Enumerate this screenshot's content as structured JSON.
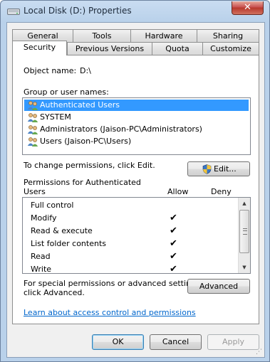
{
  "window": {
    "title": "Local Disk (D:) Properties",
    "close_label": "✕"
  },
  "tabs": {
    "row_back": [
      "General",
      "Tools",
      "Hardware",
      "Sharing"
    ],
    "row_front": [
      "Security",
      "Previous Versions",
      "Quota",
      "Customize"
    ],
    "active": "Security"
  },
  "security": {
    "object_name_label": "Object name:",
    "object_name_value": "D:\\",
    "group_label": "Group or user names:",
    "users": [
      "Authenticated Users",
      "SYSTEM",
      "Administrators (Jaison-PC\\Administrators)",
      "Users (Jaison-PC\\Users)"
    ],
    "selected_user": "Authenticated Users",
    "change_text": "To change permissions, click Edit.",
    "edit_button": "Edit...",
    "permissions_header_line1": "Permissions for Authenticated",
    "permissions_header_line2": "Users",
    "allow_label": "Allow",
    "deny_label": "Deny",
    "permissions": [
      {
        "name": "Full control",
        "allow": ""
      },
      {
        "name": "Modify",
        "allow": "✔"
      },
      {
        "name": "Read & execute",
        "allow": "✔"
      },
      {
        "name": "List folder contents",
        "allow": "✔"
      },
      {
        "name": "Read",
        "allow": "✔"
      },
      {
        "name": "Write",
        "allow": "✔"
      }
    ],
    "advanced_text_line1": "For special permissions or advanced settings,",
    "advanced_text_line2": "click Advanced.",
    "advanced_button": "Advanced",
    "learn_link": "Learn about access control and permissions"
  },
  "footer": {
    "ok": "OK",
    "cancel": "Cancel",
    "apply": "Apply"
  },
  "colors": {
    "selection": "#3399ff",
    "link": "#0066cc"
  }
}
